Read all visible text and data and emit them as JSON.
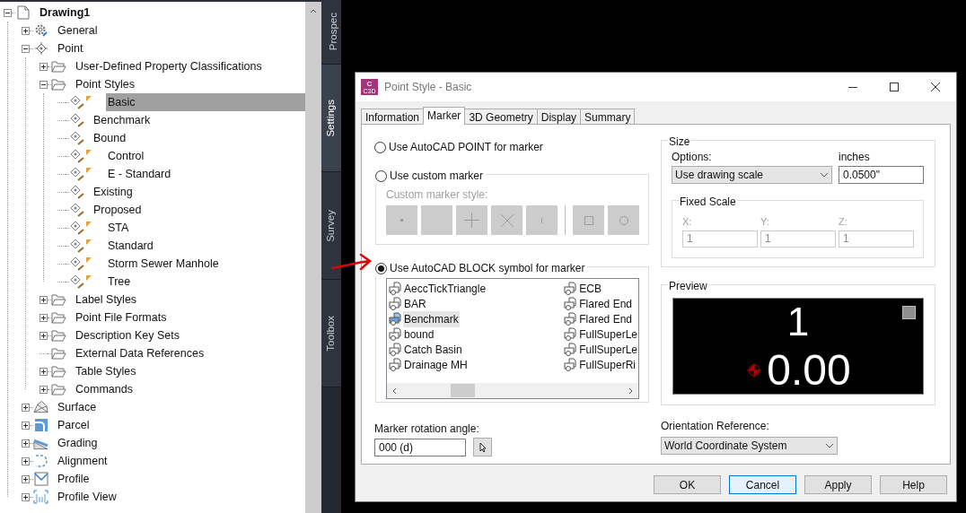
{
  "tree": {
    "items": [
      {
        "label": "Drawing1",
        "kind": "document",
        "expandable": true,
        "expanded": true,
        "children": [
          {
            "label": "General",
            "kind": "gear",
            "expandable": true,
            "expanded": false
          },
          {
            "label": "Point",
            "kind": "point",
            "expandable": true,
            "expanded": true,
            "children": [
              {
                "label": "User-Defined Property Classifications",
                "kind": "folder",
                "expandable": true,
                "expanded": false
              },
              {
                "label": "Point Styles",
                "kind": "folder",
                "expandable": true,
                "expanded": true,
                "children": [
                  {
                    "label": "Basic",
                    "kind": "style",
                    "expandable": false,
                    "flag": true,
                    "selected": true
                  },
                  {
                    "label": "Benchmark",
                    "kind": "style",
                    "expandable": false,
                    "flag": false,
                    "selected": false
                  },
                  {
                    "label": "Bound",
                    "kind": "style",
                    "expandable": false,
                    "flag": false,
                    "selected": false
                  },
                  {
                    "label": "Control",
                    "kind": "style",
                    "expandable": false,
                    "flag": true,
                    "selected": false
                  },
                  {
                    "label": "E - Standard",
                    "kind": "style",
                    "expandable": false,
                    "flag": true,
                    "selected": false
                  },
                  {
                    "label": "Existing",
                    "kind": "style",
                    "expandable": false,
                    "flag": false,
                    "selected": false
                  },
                  {
                    "label": "Proposed",
                    "kind": "style",
                    "expandable": false,
                    "flag": false,
                    "selected": false
                  },
                  {
                    "label": "STA",
                    "kind": "style",
                    "expandable": false,
                    "flag": true,
                    "selected": false
                  },
                  {
                    "label": "Standard",
                    "kind": "style",
                    "expandable": false,
                    "flag": true,
                    "selected": false
                  },
                  {
                    "label": "Storm Sewer Manhole",
                    "kind": "style",
                    "expandable": false,
                    "flag": true,
                    "selected": false
                  },
                  {
                    "label": "Tree",
                    "kind": "style",
                    "expandable": false,
                    "flag": true,
                    "selected": false
                  }
                ]
              },
              {
                "label": "Label Styles",
                "kind": "folder",
                "expandable": true,
                "expanded": false
              },
              {
                "label": "Point File Formats",
                "kind": "folder",
                "expandable": true,
                "expanded": false
              },
              {
                "label": "Description Key Sets",
                "kind": "folder",
                "expandable": true,
                "expanded": false
              },
              {
                "label": "External Data References",
                "kind": "folder",
                "expandable": false
              },
              {
                "label": "Table Styles",
                "kind": "folder",
                "expandable": true,
                "expanded": false
              },
              {
                "label": "Commands",
                "kind": "folder",
                "expandable": true,
                "expanded": false
              }
            ]
          },
          {
            "label": "Surface",
            "kind": "surface",
            "expandable": true,
            "expanded": false
          },
          {
            "label": "Parcel",
            "kind": "parcel",
            "expandable": true,
            "expanded": false
          },
          {
            "label": "Grading",
            "kind": "grading",
            "expandable": true,
            "expanded": false
          },
          {
            "label": "Alignment",
            "kind": "alignment",
            "expandable": true,
            "expanded": false
          },
          {
            "label": "Profile",
            "kind": "profile",
            "expandable": true,
            "expanded": false
          },
          {
            "label": "Profile View",
            "kind": "profile-view",
            "expandable": true,
            "expanded": false
          }
        ]
      }
    ]
  },
  "side_tabs": [
    {
      "label": "Prospec",
      "selected": false
    },
    {
      "label": "Settings",
      "selected": true
    },
    {
      "label": "Survey",
      "selected": false
    },
    {
      "label": "Toolbox",
      "selected": false
    }
  ],
  "dialog": {
    "title": "Point Style - Basic",
    "app_icon": {
      "letter": "C",
      "caption": "C3D"
    },
    "tabs": [
      {
        "label": "Information",
        "selected": false
      },
      {
        "label": "Marker",
        "selected": true
      },
      {
        "label": "3D Geometry",
        "selected": false
      },
      {
        "label": "Display",
        "selected": false
      },
      {
        "label": "Summary",
        "selected": false
      }
    ],
    "marker_options": [
      {
        "label": "Use AutoCAD POINT for marker",
        "selected": false
      },
      {
        "label": "Use custom marker",
        "selected": false
      },
      {
        "label": "Use AutoCAD BLOCK symbol for marker",
        "selected": true
      }
    ],
    "custom_marker": {
      "label": "Custom marker style:",
      "disabled": true,
      "types": [
        {
          "kind": "dot"
        },
        {
          "kind": "none"
        },
        {
          "kind": "plus"
        },
        {
          "kind": "cross"
        },
        {
          "kind": "tick"
        }
      ],
      "modifiers": [
        {
          "kind": "square"
        },
        {
          "kind": "circle"
        }
      ]
    },
    "blocks": {
      "columns": [
        [
          {
            "label": "AeccTickTriangle",
            "selected": false
          },
          {
            "label": "BAR",
            "selected": false
          },
          {
            "label": "Benchmark",
            "selected": true
          },
          {
            "label": "bound",
            "selected": false
          },
          {
            "label": "Catch Basin",
            "selected": false
          },
          {
            "label": "Drainage MH",
            "selected": false
          }
        ],
        [
          {
            "label": "ECB",
            "selected": false
          },
          {
            "label": "Flared End",
            "selected": false
          },
          {
            "label": "Flared End",
            "selected": false
          },
          {
            "label": "FullSuperLe",
            "selected": false
          },
          {
            "label": "FullSuperLe",
            "selected": false
          },
          {
            "label": "FullSuperRi",
            "selected": false
          }
        ]
      ]
    },
    "rotation": {
      "label": "Marker rotation angle:",
      "value": "000 (d)"
    },
    "size": {
      "title": "Size",
      "options_label": "Options:",
      "option": "Use drawing scale",
      "units_label": "inches",
      "value": "0.0500\"",
      "fixed_scale": {
        "title": "Fixed Scale",
        "disabled": true,
        "axes": [
          {
            "label": "X:",
            "value": "1"
          },
          {
            "label": "Y:",
            "value": "1"
          },
          {
            "label": "Z:",
            "value": "1"
          }
        ]
      }
    },
    "preview": {
      "title": "Preview",
      "top_text": "1",
      "bottom_text": "0.00"
    },
    "orientation": {
      "label": "Orientation Reference:",
      "value": "World Coordinate System"
    },
    "buttons": [
      {
        "label": "OK",
        "focused": false
      },
      {
        "label": "Cancel",
        "focused": true
      },
      {
        "label": "Apply",
        "focused": false
      },
      {
        "label": "Help",
        "focused": false
      }
    ]
  }
}
